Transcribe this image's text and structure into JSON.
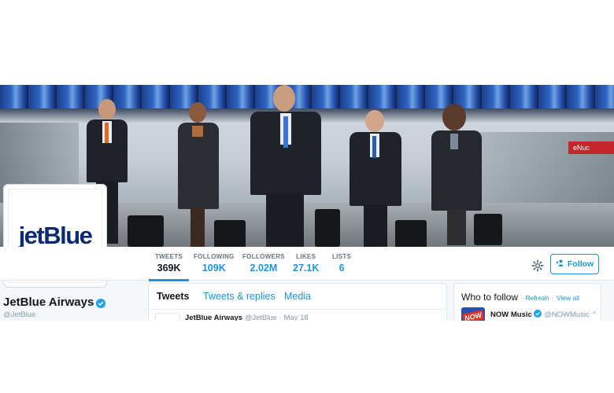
{
  "profile": {
    "display_name": "JetBlue Airways",
    "handle": "@JetBlue",
    "avatar_logo_text": "jetBlue",
    "banner_sign_text": "eNuc"
  },
  "stats": [
    {
      "label": "TWEETS",
      "value": "369K"
    },
    {
      "label": "FOLLOWING",
      "value": "109K"
    },
    {
      "label": "FOLLOWERS",
      "value": "2.02M"
    },
    {
      "label": "LIKES",
      "value": "27.1K"
    },
    {
      "label": "LISTS",
      "value": "6"
    }
  ],
  "actions": {
    "follow_label": "Follow"
  },
  "timeline": {
    "tabs": [
      "Tweets",
      "Tweets & replies",
      "Media"
    ],
    "tweet": {
      "name": "JetBlue Airways",
      "handle": "@JetBlue",
      "separator": "·",
      "date": "May 18"
    }
  },
  "who_to_follow": {
    "title": "Who to follow",
    "separator": "·",
    "refresh_label": "Refresh",
    "view_all_label": "View all",
    "suggestion": {
      "name": "NOW Music",
      "handle": "@NOWMusic",
      "thumb_text": "NOW"
    },
    "close_glyph": "×"
  },
  "colors": {
    "accent": "#1b95e0",
    "brand_navy": "#0b2a72",
    "verified_blue": "#1da1f2"
  },
  "icons": [
    "gear-icon",
    "add-user-icon",
    "verified-icon",
    "close-icon"
  ]
}
